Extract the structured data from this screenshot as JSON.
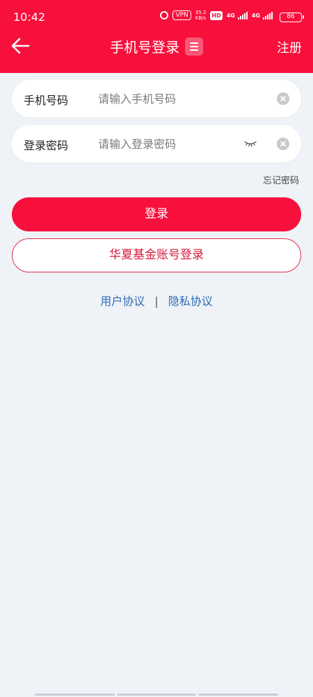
{
  "status_bar": {
    "time": "10:42",
    "vpn": "VPN",
    "speed_value": "35.2",
    "speed_unit": "KB/s",
    "hd": "HD",
    "net1": "4G",
    "net2": "4G",
    "battery": "86"
  },
  "nav": {
    "title": "手机号登录",
    "register": "注册"
  },
  "phone_field": {
    "label": "手机号码",
    "placeholder": "请输入手机号码",
    "value": ""
  },
  "password_field": {
    "label": "登录密码",
    "placeholder": "请输入登录密码",
    "value": ""
  },
  "forgot_password": "忘记密码",
  "login_button": "登录",
  "fund_login_button": "华夏基金账号登录",
  "agreements": {
    "user": "用户协议",
    "separator": "|",
    "privacy": "隐私协议"
  },
  "colors": {
    "brand_red": "#f7103c",
    "link_blue": "#2c6bb5",
    "background": "#eff2f6"
  }
}
